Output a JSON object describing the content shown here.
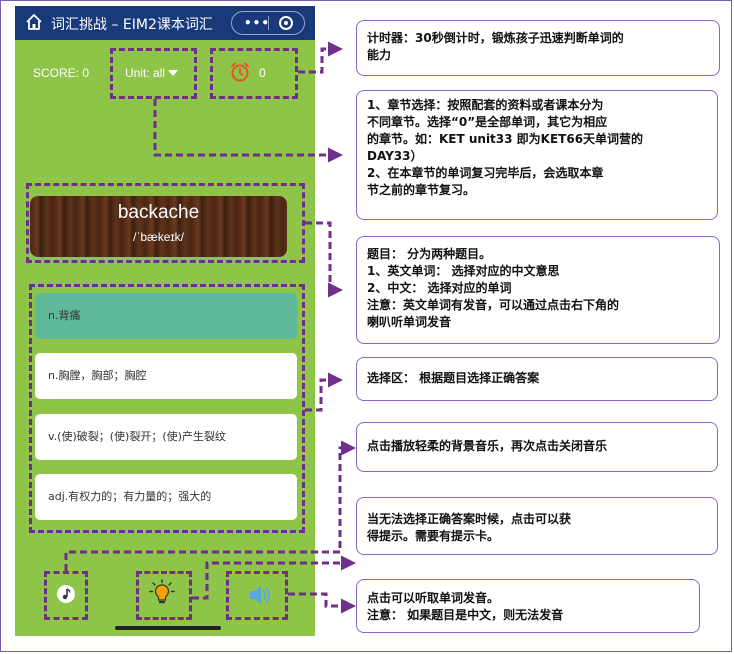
{
  "app": {
    "title": "词汇挑战 – EIM2课本词汇",
    "more_icon": "more-dots-icon",
    "close_icon": "target-circle-icon"
  },
  "status": {
    "score_label": "SCORE: 0",
    "unit_label": "Unit: all",
    "timer_value": "0"
  },
  "question": {
    "word": "backache",
    "phonetic": "/ˈbækeɪk/"
  },
  "options": [
    {
      "label": "n.背痛",
      "selected": true
    },
    {
      "label": "n.胸膛，胸部；胸腔",
      "selected": false
    },
    {
      "label": "v.(使)破裂；(使)裂开；(使)产生裂纹",
      "selected": false
    },
    {
      "label": "adj.有权力的；有力量的；强大的",
      "selected": false
    }
  ],
  "toolbar": {
    "music_icon": "music-note-icon",
    "hint_icon": "lightbulb-icon",
    "speaker_icon": "speaker-icon"
  },
  "notes": {
    "timer": [
      "计时器：30秒倒计时，锻炼孩子迅速判断单词的",
      "能力"
    ],
    "unit": [
      "1、章节选择：按照配套的资料或者课本分为",
      "不同章节。选择“0”是全部单词，其它为相应",
      "的章节。如：KET unit33 即为KET66天单词营的",
      "DAY33）",
      "2、在本章节的单词复习完毕后，会选取本章",
      "节之前的章节复习。"
    ],
    "question": [
      "题目： 分为两种题目。",
      "1、英文单词： 选择对应的中文意思",
      "2、中文：  选择对应的单词",
      "注意：英文单词有发音，可以通过点击右下角的",
      "喇叭听单词发音"
    ],
    "options": [
      "选择区： 根据题目选择正确答案"
    ],
    "music": [
      "点击播放轻柔的背景音乐，再次点击关闭音乐"
    ],
    "hint": [
      "当无法选择正确答案时候，点击可以获",
      "得提示。需要有提示卡。"
    ],
    "speaker": [
      "点击可以听取单词发音。",
      "注意： 如果题目是中文，则无法发音"
    ]
  },
  "colors": {
    "titlebar": "#183a7a",
    "background": "#8ec549",
    "selected_option": "#5fb89a",
    "annotation": "#6f2f8c",
    "hint_icon": "#f2a400",
    "speaker_icon": "#5aa7e0",
    "timer_icon": "#e8542f"
  }
}
